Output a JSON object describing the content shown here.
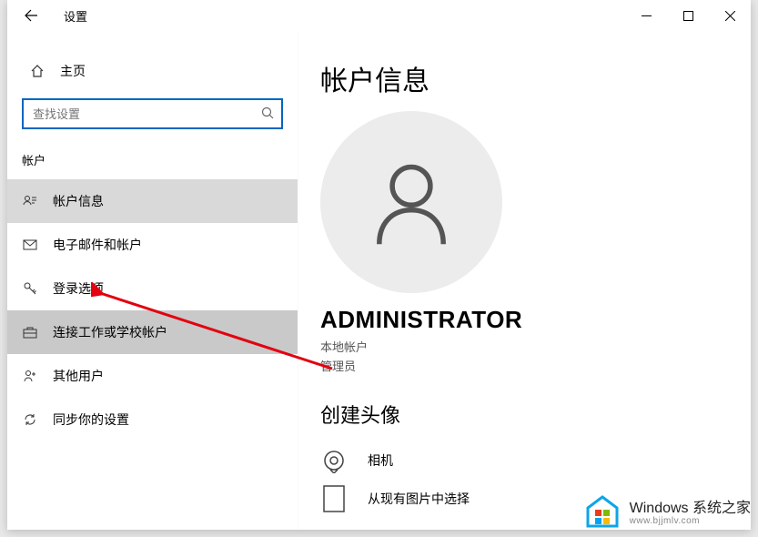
{
  "titlebar": {
    "title": "设置"
  },
  "sidebar": {
    "home": "主页",
    "searchPlaceholder": "查找设置",
    "sectionLabel": "帐户",
    "items": [
      {
        "label": "帐户信息"
      },
      {
        "label": "电子邮件和帐户"
      },
      {
        "label": "登录选项"
      },
      {
        "label": "连接工作或学校帐户"
      },
      {
        "label": "其他用户"
      },
      {
        "label": "同步你的设置"
      }
    ]
  },
  "main": {
    "pageTitle": "帐户信息",
    "username": "ADMINISTRATOR",
    "accountType": "本地帐户",
    "role": "管理员",
    "createAvatar": "创建头像",
    "camera": "相机",
    "browse": "从现有图片中选择"
  },
  "watermark": {
    "line1": "Windows 系统之家",
    "line2": "www.bjjmlv.com"
  }
}
